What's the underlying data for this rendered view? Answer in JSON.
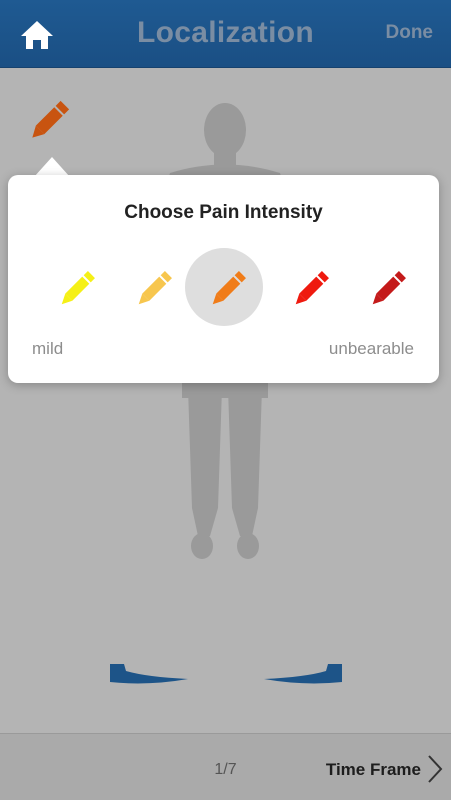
{
  "navbar": {
    "title": "Localization",
    "done_label": "Done",
    "home_icon": "home-icon"
  },
  "current_pencil": {
    "icon": "pencil-icon",
    "color": "#c85410"
  },
  "popover": {
    "title": "Choose Pain Intensity",
    "options": [
      {
        "name": "intensity-1",
        "color": "#f5f016",
        "selected": false
      },
      {
        "name": "intensity-2",
        "color": "#f7c64e",
        "selected": false
      },
      {
        "name": "intensity-3",
        "color": "#f07c19",
        "selected": true
      },
      {
        "name": "intensity-4",
        "color": "#ef1a0f",
        "selected": false
      },
      {
        "name": "intensity-5",
        "color": "#c41a1a",
        "selected": false
      }
    ],
    "min_label": "mild",
    "max_label": "unbearable"
  },
  "rotation": {
    "accent": "#1d5488"
  },
  "toolbar": {
    "page_indicator": "1/7",
    "next_label": "Time Frame"
  }
}
